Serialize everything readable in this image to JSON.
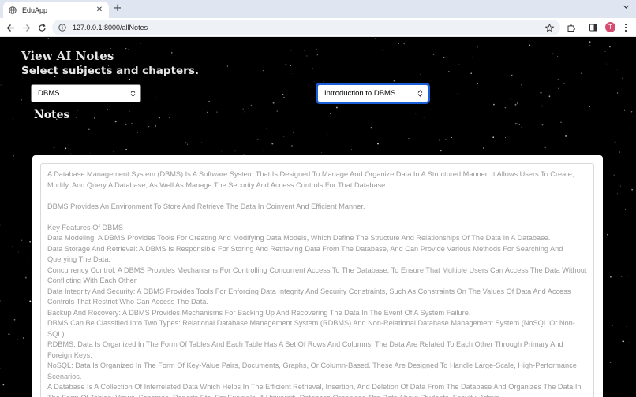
{
  "browser": {
    "tab_title": "EduApp",
    "url": "127.0.0.1:8000/allNotes",
    "profile_initial": "T"
  },
  "page": {
    "title": "View AI Notes",
    "subtitle": "Select subjects and chapters.",
    "subject_select": {
      "value": "DBMS"
    },
    "chapter_select": {
      "value": "Introduction to DBMS"
    },
    "notes_heading": "Notes",
    "notes": [
      "A Database Management System (DBMS) Is A Software System That Is Designed To Manage And Organize Data In A Structured Manner. It Allows Users To Create, Modify, And Query A Database, As Well As Manage The Security And Access Controls For That Database.",
      "",
      "DBMS Provides An Environment To Store And Retrieve The Data In Coinvent And Efficient Manner.",
      "",
      "Key Features Of DBMS",
      "Data Modeling: A DBMS Provides Tools For Creating And Modifying Data Models, Which Define The Structure And Relationships Of The Data In A Database.",
      "Data Storage And Retrieval: A DBMS Is Responsible For Storing And Retrieving Data From The Database, And Can Provide Various Methods For Searching And Querying The Data.",
      "Concurrency Control: A DBMS Provides Mechanisms For Controlling Concurrent Access To The Database, To Ensure That Multiple Users Can Access The Data Without Conflicting With Each Other.",
      "Data Integrity And Security: A DBMS Provides Tools For Enforcing Data Integrity And Security Constraints, Such As Constraints On The Values Of Data And Access Controls That Restrict Who Can Access The Data.",
      "Backup And Recovery: A DBMS Provides Mechanisms For Backing Up And Recovering The Data In The Event Of A System Failure.",
      "DBMS Can Be Classified Into Two Types: Relational Database Management System (RDBMS) And Non-Relational Database Management System (NoSQL Or Non-SQL)",
      "RDBMS: Data Is Organized In The Form Of Tables And Each Table Has A Set Of Rows And Columns. The Data Are Related To Each Other Through Primary And Foreign Keys.",
      "NoSQL: Data Is Organized In The Form Of Key-Value Pairs, Documents, Graphs, Or Column-Based. These Are Designed To Handle Large-Scale, High-Performance Scenarios.",
      "A Database Is A Collection Of Interrelated Data Which Helps In The Efficient Retrieval, Insertion, And Deletion Of Data From The Database And Organizes The Data In The Form Of Tables, Views, Schemas, Reports Etc. For Example, A University Database Organizes The Data About Students, Faculty, Admin"
    ]
  },
  "colors": {
    "chapter_focus": "#1a5fd6",
    "profile_avatar": "#d64d6f"
  }
}
